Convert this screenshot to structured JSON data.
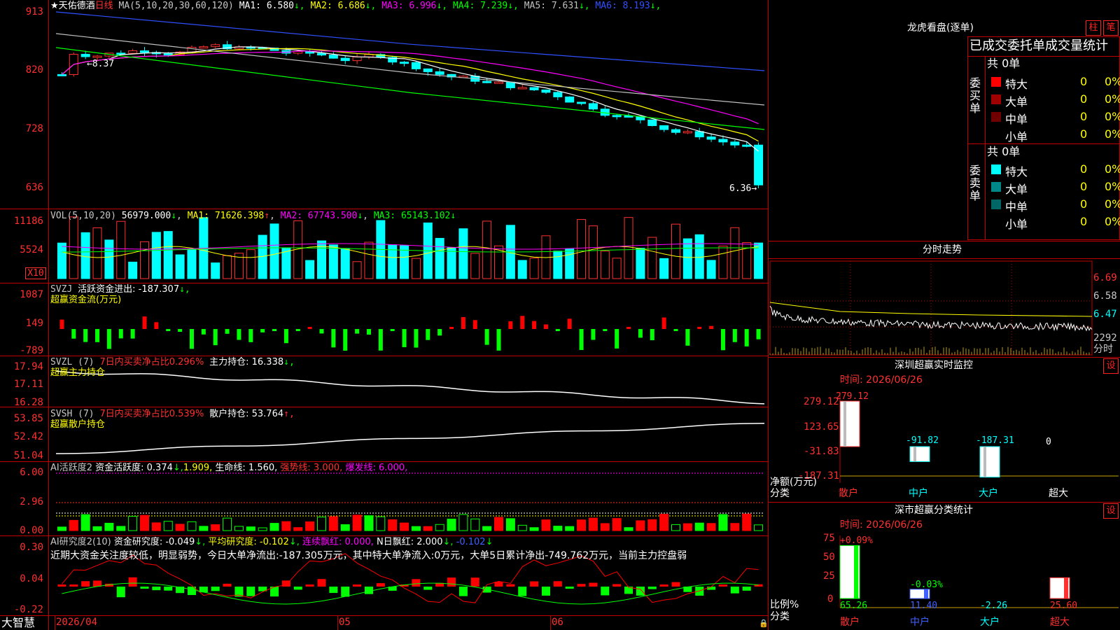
{
  "main_chart": {
    "stock_name": "★天佑德酒",
    "period": "日线",
    "ma_params": "MA(5,10,20,30,60,120)",
    "ma_legend": [
      {
        "name": "MA1",
        "value": "6.580",
        "arrow": "↓",
        "color": "#ffffff"
      },
      {
        "name": "MA2",
        "value": "6.686",
        "arrow": "↓",
        "color": "#ffff00"
      },
      {
        "name": "MA3",
        "value": "6.996",
        "arrow": "↓",
        "color": "#ff00ff"
      },
      {
        "name": "MA4",
        "value": "7.239",
        "arrow": "↓",
        "color": "#00ff00"
      },
      {
        "name": "MA5",
        "value": "7.631",
        "arrow": "↓",
        "color": "#c0c0c0"
      },
      {
        "name": "MA6",
        "value": "8.193",
        "arrow": "↓",
        "color": "#3050ff"
      }
    ],
    "y_ticks": [
      "913",
      "820",
      "728",
      "636"
    ],
    "high_label": "8.37",
    "low_label": "6.36"
  },
  "volume": {
    "title": "VOL(5,10,20)",
    "value": "56979.000",
    "value_arrow": "↓",
    "ma1": "MA1: 71626.398",
    "ma1_arrow": "↑",
    "ma2": "MA2: 67743.500",
    "ma2_arrow": "↓",
    "ma3": "MA3: 65143.102",
    "ma3_arrow": "↓",
    "y_ticks": [
      "11186",
      "5524"
    ],
    "unit": "X10"
  },
  "svzj": {
    "title": "SVZJ",
    "field": "活跃资金进出: -187.307",
    "arrow": "↓,",
    "subtitle": "超赢资金流(万元)",
    "y_ticks": [
      "1087",
      "149",
      "-789"
    ]
  },
  "svzl": {
    "title": "SVZL (7)",
    "ratio": "7日内买卖净占比0.296%",
    "hold": "主力持仓: 16.338",
    "arrow": "↓,",
    "subtitle": "超赢主力持仓",
    "y_ticks": [
      "17.94",
      "17.11",
      "16.28"
    ]
  },
  "svsh": {
    "title": "SVSH (7)",
    "ratio": "7日内买卖净占比0.539%",
    "hold": "散户持仓: 53.764",
    "arrow": "↑,",
    "subtitle": "超赢散户持仓",
    "y_ticks": [
      "53.85",
      "52.42",
      "51.04"
    ]
  },
  "ai_active": {
    "title": "AI活跃度2",
    "f1": "资金活跃度: 0.374",
    "f1_arrow": "↓,",
    "f2": "1.909,",
    "f3": "生命线: 1.560,",
    "f4": "强势线: 3.000,",
    "f5": "爆发线: 6.000,",
    "y_ticks": [
      "6.00",
      "2.96",
      "0.00"
    ]
  },
  "ai_research": {
    "title": "AI研究度2(10)",
    "f1": "资金研究度: -0.049",
    "f1_arrow": "↓,",
    "f2": "平均研究度: -0.102",
    "f2_arrow": "↓,",
    "f3": "连续飘红: 0.000,",
    "f4": "N日飘红: 2.000",
    "f4_arrow": "↓,",
    "f5": "-0.102",
    "f5_arrow": "↓",
    "comment": "近期大资金关注度较低，明显弱势，今日大单净流出:-187.305万元，其中特大单净流入:0万元，大单5日累计净出-749.762万元，当前主力控盘弱",
    "y_ticks": [
      "0.30",
      "0.04",
      "-0.22"
    ]
  },
  "time_axis": {
    "brand": "大智慧",
    "date_start": "2026/04",
    "m05": "05",
    "m06": "06"
  },
  "dragon_tiger": {
    "title": "龙虎看盘(逐单)",
    "btn_column": "柱",
    "btn_stroke": "笔",
    "header": "已成交委托单成交量统计",
    "buy_label": "委买单",
    "sell_label": "委卖单",
    "buy_total": "共 0单",
    "sell_total": "共 0单",
    "buy_rows": [
      {
        "name": "特大",
        "count": "0",
        "pct": "0%",
        "color": "#ff0000"
      },
      {
        "name": "大单",
        "count": "0",
        "pct": "0%",
        "color": "#a00000"
      },
      {
        "name": "中单",
        "count": "0",
        "pct": "0%",
        "color": "#700000"
      },
      {
        "name": "小单",
        "count": "0",
        "pct": "0%",
        "color": ""
      }
    ],
    "sell_rows": [
      {
        "name": "特大",
        "count": "0",
        "pct": "0%",
        "color": "#00ffff"
      },
      {
        "name": "大单",
        "count": "0",
        "pct": "0%",
        "color": "#008888"
      },
      {
        "name": "中单",
        "count": "0",
        "pct": "0%",
        "color": "#006666"
      },
      {
        "name": "小单",
        "count": "0",
        "pct": "0%",
        "color": ""
      }
    ]
  },
  "intraday": {
    "title": "分时走势",
    "y_ticks": [
      "6.69",
      "6.58",
      "6.47"
    ],
    "vol_label": "2292",
    "footer": "分时"
  },
  "monitor": {
    "title": "深圳超赢实时监控",
    "set_btn": "设",
    "time": "时间: 2026/06/26",
    "y_ticks": [
      "279.12",
      "123.65",
      "-31.83",
      "-187.31"
    ],
    "label1": "净额(万元)",
    "label2": "分类",
    "bars": [
      {
        "name": "散户",
        "value": 279.12,
        "label": "279.12"
      },
      {
        "name": "中户",
        "value": -91.82,
        "label": "-91.82"
      },
      {
        "name": "大户",
        "value": -187.31,
        "label": "-187.31"
      },
      {
        "name": "超大",
        "value": 0,
        "label": "0"
      }
    ]
  },
  "category_stats": {
    "title": "深市超赢分类统计",
    "set_btn": "设",
    "time": "时间: 2026/06/26",
    "y_ticks": [
      "75",
      "50",
      "25",
      "0"
    ],
    "label1": "比例%",
    "label2": "分类",
    "bars": [
      {
        "name": "散户",
        "value": 65.26,
        "change": "+0.09%",
        "bottom": "65.26",
        "color": "#00ff00"
      },
      {
        "name": "中户",
        "value": 11.4,
        "change": "-0.03%",
        "bottom": "11.40",
        "color": "#4060ff"
      },
      {
        "name": "大户",
        "value": -2.26,
        "change": "",
        "bottom": "-2.26",
        "color": "#00ffff"
      },
      {
        "name": "超大",
        "value": 25.6,
        "change": "",
        "bottom": "25.60",
        "color": "#ff3030"
      }
    ]
  },
  "colors": {
    "up": "#ff3030",
    "down": "#00ffff",
    "frame": "#c00000",
    "axis": "#ff3030",
    "flow_up": "#ff0000",
    "flow_down": "#00ff00"
  }
}
